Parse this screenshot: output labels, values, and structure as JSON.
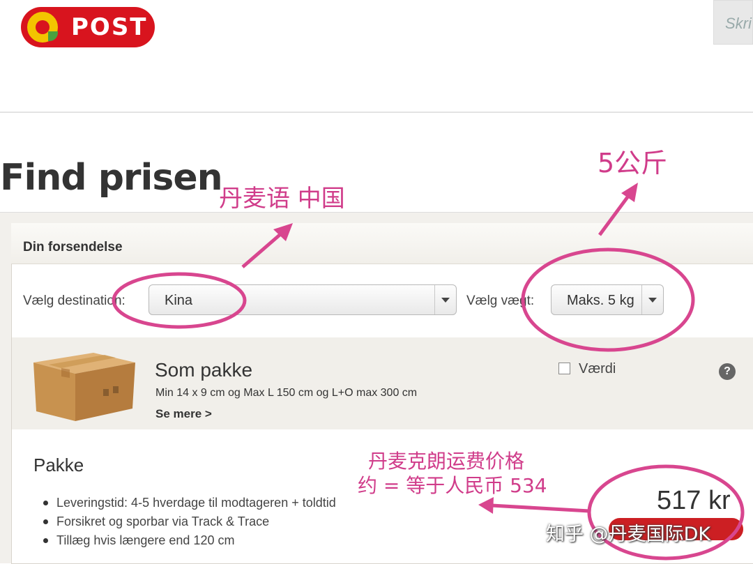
{
  "header": {
    "logo_text": "POST",
    "search_placeholder": "Skri"
  },
  "page": {
    "title": "Find prisen"
  },
  "shipment": {
    "heading": "Din forsendelse",
    "destination_label": "Vælg destination:",
    "destination_value": "Kina",
    "weight_label": "Vælg vægt:",
    "weight_value": "Maks. 5 kg"
  },
  "product": {
    "title": "Som pakke",
    "dimensions": "Min 14 x 9 cm og Max L 150 cm og L+O max 300 cm",
    "see_more": "Se mere >",
    "value_checkbox_label": "Værdi",
    "value_checked": false,
    "help_icon": "?"
  },
  "result": {
    "title": "Pakke",
    "bullets": [
      "Leveringstid: 4-5 hverdage til modtageren + toldtid",
      "Forsikret og sporbar via Track & Trace",
      "Tillæg hvis længere end 120 cm"
    ],
    "price": "517 kr"
  },
  "annotations": {
    "destination_note": "丹麦语 中国",
    "weight_note": "5公斤",
    "price_note_line1": "丹麦克朗运费价格",
    "price_note_line2": "约 = 等于人民币 534"
  },
  "watermark": "知乎 @丹麦国际DK",
  "colors": {
    "brand_red": "#d8141e",
    "brand_yellow": "#f3c400",
    "annotation_pink": "#d03c8a",
    "buy_button": "#cc1f23"
  }
}
